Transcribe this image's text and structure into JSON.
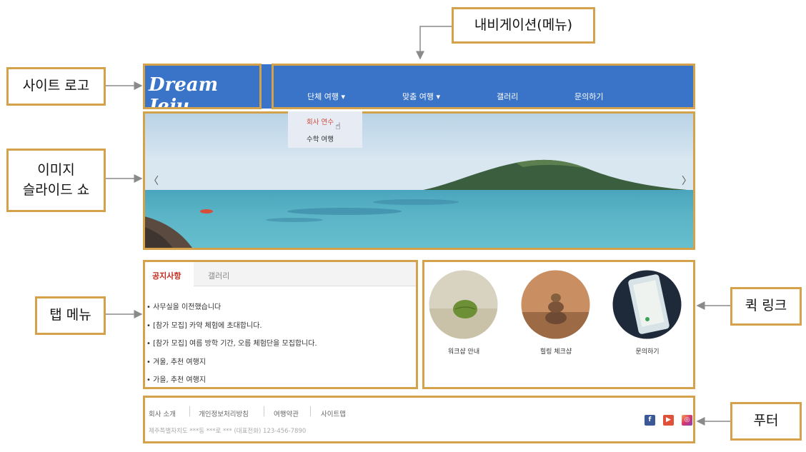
{
  "callouts": {
    "navigation": "내비게이션(메뉴)",
    "logo": "사이트 로고",
    "slideshow_line1": "이미지",
    "slideshow_line2": "슬라이드 쇼",
    "tabmenu": "탭 메뉴",
    "quicklink": "퀵 링크",
    "footer": "푸터"
  },
  "site": {
    "logo": "Dream Jeju",
    "nav": [
      "단체 여행",
      "맞춤 여행",
      "갤러리",
      "문의하기"
    ],
    "dropdown": [
      "회사 연수",
      "수학 여행"
    ],
    "slider_prev": "〈",
    "slider_next": "〉"
  },
  "tabs": {
    "active": "공지사항",
    "other": "갤러리",
    "notices": [
      "사무실을 이전했습니다",
      "[참가 모집] 카약 체험에 초대합니다.",
      "[참가 모집] 여름 방학 기간, 오름 체험단을 모집합니다.",
      "겨울, 추천 여행지",
      "가을, 추천 여행지"
    ]
  },
  "quicklinks": [
    "워크샵 안내",
    "힐링 체크샵",
    "문의하기"
  ],
  "footer": {
    "links": [
      "회사 소개",
      "개인정보처리방침",
      "여행약관",
      "사이트맵"
    ],
    "address": "제주특별자치도 ***동 ***로 *** (대표전화) 123-456-7890",
    "social": [
      "facebook-icon",
      "youtube-icon",
      "instagram-icon"
    ]
  },
  "colors": {
    "accent": "#d4a24a",
    "brand": "#3a74c8",
    "active_tab": "#c02a1e"
  }
}
